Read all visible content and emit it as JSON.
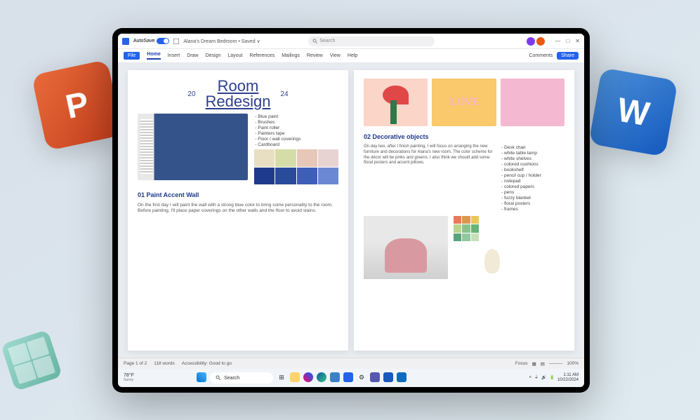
{
  "titlebar": {
    "autosave_label": "AutoSave",
    "doc": "Alana's Dream Bedroom • Saved ∨",
    "search_placeholder": "Search"
  },
  "ribbon": {
    "tabs": [
      "File",
      "Home",
      "Insert",
      "Draw",
      "Design",
      "Layout",
      "References",
      "Mailings",
      "Review",
      "View",
      "Help"
    ],
    "comments": "Comments",
    "share": "Share"
  },
  "page1": {
    "year_left": "20",
    "year_right": "24",
    "title_l1": "Room",
    "title_l2": "Redesign",
    "supplies": [
      "Blue paint",
      "Brushes",
      "Paint roller",
      "Painters tape",
      "Floor / wall coverings",
      "Cardboard"
    ],
    "section": "01 Paint Accent Wall",
    "body": "On the first day I will paint the wall with a strong blue color to bring some personality to the room. Before painting, I'll place paper coverings on the other walls and the floor to avoid stains.",
    "swatches": [
      "#e8dfc2",
      "#d4dda8",
      "#e7c7b8",
      "#e8d3d3",
      "#1e3a8a",
      "#2a4a9a",
      "#3e5eb8",
      "#6a88d4"
    ]
  },
  "page2": {
    "love_text": "LOVE",
    "section": "02 Decorative objects",
    "body": "On day two, after I finish painting, I will focus on arranging the new furniture and decorations for Alana's new room. The color scheme for the décor will be pinks and greens. I also think we should add some floral posters and accent pillows.",
    "items": [
      "Desk chair",
      "white table lamp",
      "white shelves",
      "colored cushions",
      "bookshelf",
      "pencil cup / holder",
      "notepad",
      "colored papers",
      "pens",
      "fuzzy blanket",
      "floral posters",
      "frames"
    ],
    "mini_swatches": [
      "#e87a5a",
      "#d89a4a",
      "#e8c85a",
      "#b8d48a",
      "#88c488",
      "#68b478",
      "#58a47a",
      "#90c8a0",
      "#c8e0b8"
    ]
  },
  "statusbar": {
    "page": "Page 1 of 2",
    "words": "118 words",
    "accessibility": "Accessibility: Good to go",
    "focus": "Focus",
    "zoom": "100%"
  },
  "taskbar": {
    "weather": "78°F",
    "weather_sub": "Sunny",
    "search": "Search",
    "time": "1:11 AM",
    "date": "10/22/2024",
    "icons": [
      "start",
      "search",
      "widgets",
      "explorer",
      "edge",
      "store",
      "photos",
      "settings",
      "copilot",
      "teams",
      "word",
      "outlook"
    ]
  }
}
